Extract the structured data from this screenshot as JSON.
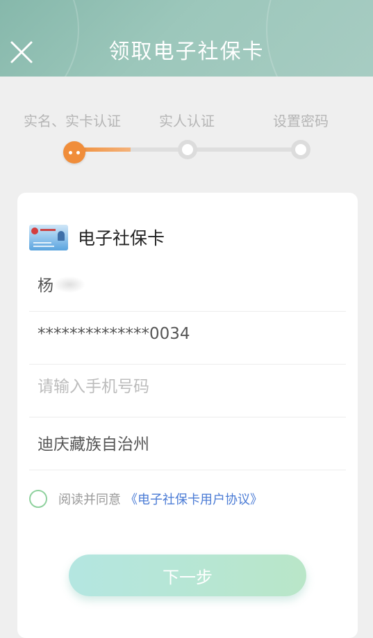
{
  "header": {
    "title": "领取电子社保卡",
    "close_icon": "close-icon"
  },
  "steps": [
    {
      "label": "实名、实卡认证",
      "state": "active"
    },
    {
      "label": "实人认证",
      "state": "pending"
    },
    {
      "label": "设置密码",
      "state": "pending"
    }
  ],
  "progress": 0.25,
  "card": {
    "title": "电子社保卡",
    "icon": "social-security-card-icon"
  },
  "fields": {
    "name_visible": "杨",
    "id_number": "**************0034",
    "phone_placeholder": "请输入手机号码",
    "region": "迪庆藏族自治州"
  },
  "agreement": {
    "text": "阅读并同意",
    "link": "《电子社保卡用户协议》"
  },
  "next_button": "下一步",
  "colors": {
    "header": "#9cc7bb",
    "active_step": "#f08d3a",
    "link": "#4a7bd5",
    "radio_border": "#8fd19e"
  }
}
